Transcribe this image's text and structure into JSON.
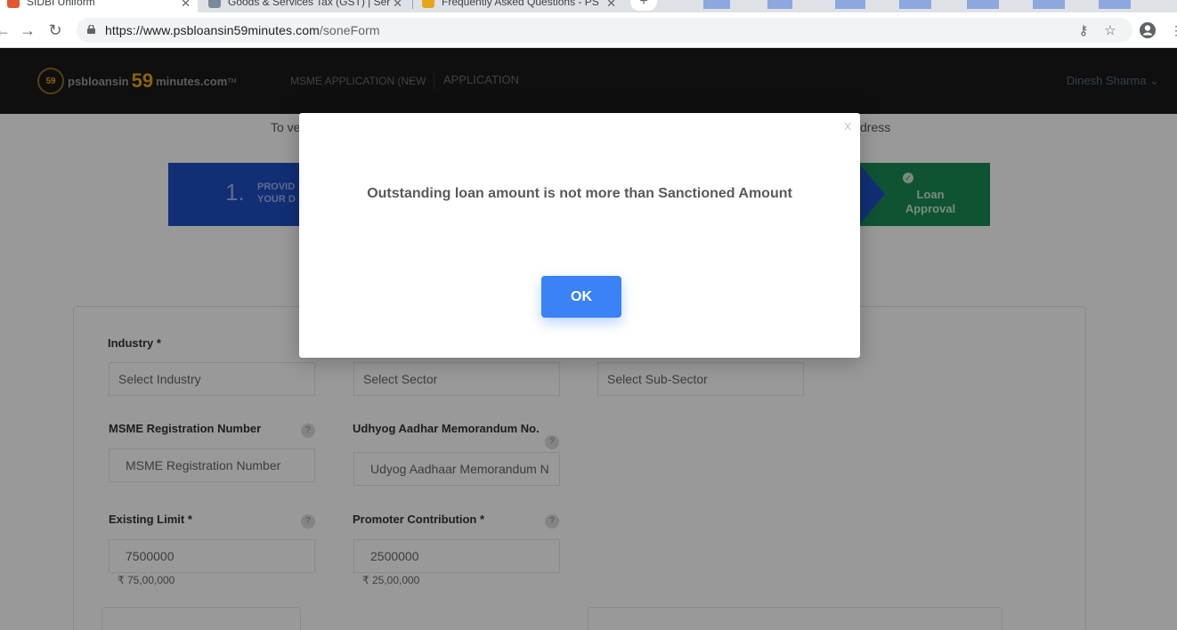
{
  "browser": {
    "tabs": [
      {
        "title": "SIDBI Uniform",
        "active": true
      },
      {
        "title": "Goods & Services Tax (GST) | Ser",
        "active": false
      },
      {
        "title": "Frequently Asked Questions - PS",
        "active": false
      }
    ],
    "new_tab_symbol": "+",
    "url_host": "https://www.psbloansin59minutes.com",
    "url_path": "/soneForm",
    "icons": {
      "back": "back-arrow-icon",
      "forward": "forward-arrow-icon",
      "reload": "reload-icon",
      "lock": "lock-icon",
      "key": "key-icon",
      "star": "star-icon",
      "profile": "profile-icon",
      "menu": "menu-dots-icon"
    }
  },
  "header": {
    "logo_badge": "59",
    "logo_prefix": "psbloansin",
    "logo_number": "59",
    "logo_suffix": "minutes.com",
    "logo_tm": "TM",
    "nav_msme": "MSME APPLICATION (NEW",
    "nav_application": "APPLICATION",
    "user_name": "Dinesh Sharma",
    "user_chevron": "⌄"
  },
  "page": {
    "verify_left": "To ve",
    "verify_right": "dress",
    "step1_number": "1.",
    "step1_label_line1": "PROVID",
    "step1_label_line2": "YOUR D",
    "step4_label_line1": "Loan",
    "step4_label_line2": "Approval"
  },
  "form": {
    "industry_label": "Industry *",
    "industry_placeholder": "Select Industry",
    "sector_placeholder": "Select Sector",
    "subsector_placeholder": "Select Sub-Sector",
    "msme_reg_label": "MSME Registration Number",
    "msme_reg_placeholder": "MSME Registration Number",
    "udyog_label": "Udhyog Aadhar Memorandum No.",
    "udyog_placeholder": "Udyog Aadhaar Memorandum N",
    "existing_limit_label": "Existing Limit *",
    "existing_limit_value": "7500000",
    "existing_limit_words": "₹ 75,00,000",
    "promoter_label": "Promoter Contribution *",
    "promoter_value": "2500000",
    "promoter_words": "₹ 25,00,000",
    "help_symbol": "?"
  },
  "modal": {
    "close_label": "x",
    "message": "Outstanding loan amount is not more than Sanctioned Amount",
    "ok_label": "OK"
  },
  "colors": {
    "accent_button": "#3b82f6",
    "header_bg": "#1a1a1a",
    "step_blue": "#1f4fc4",
    "step_green": "#1a8a55",
    "logo_gold": "#e8a51a"
  }
}
